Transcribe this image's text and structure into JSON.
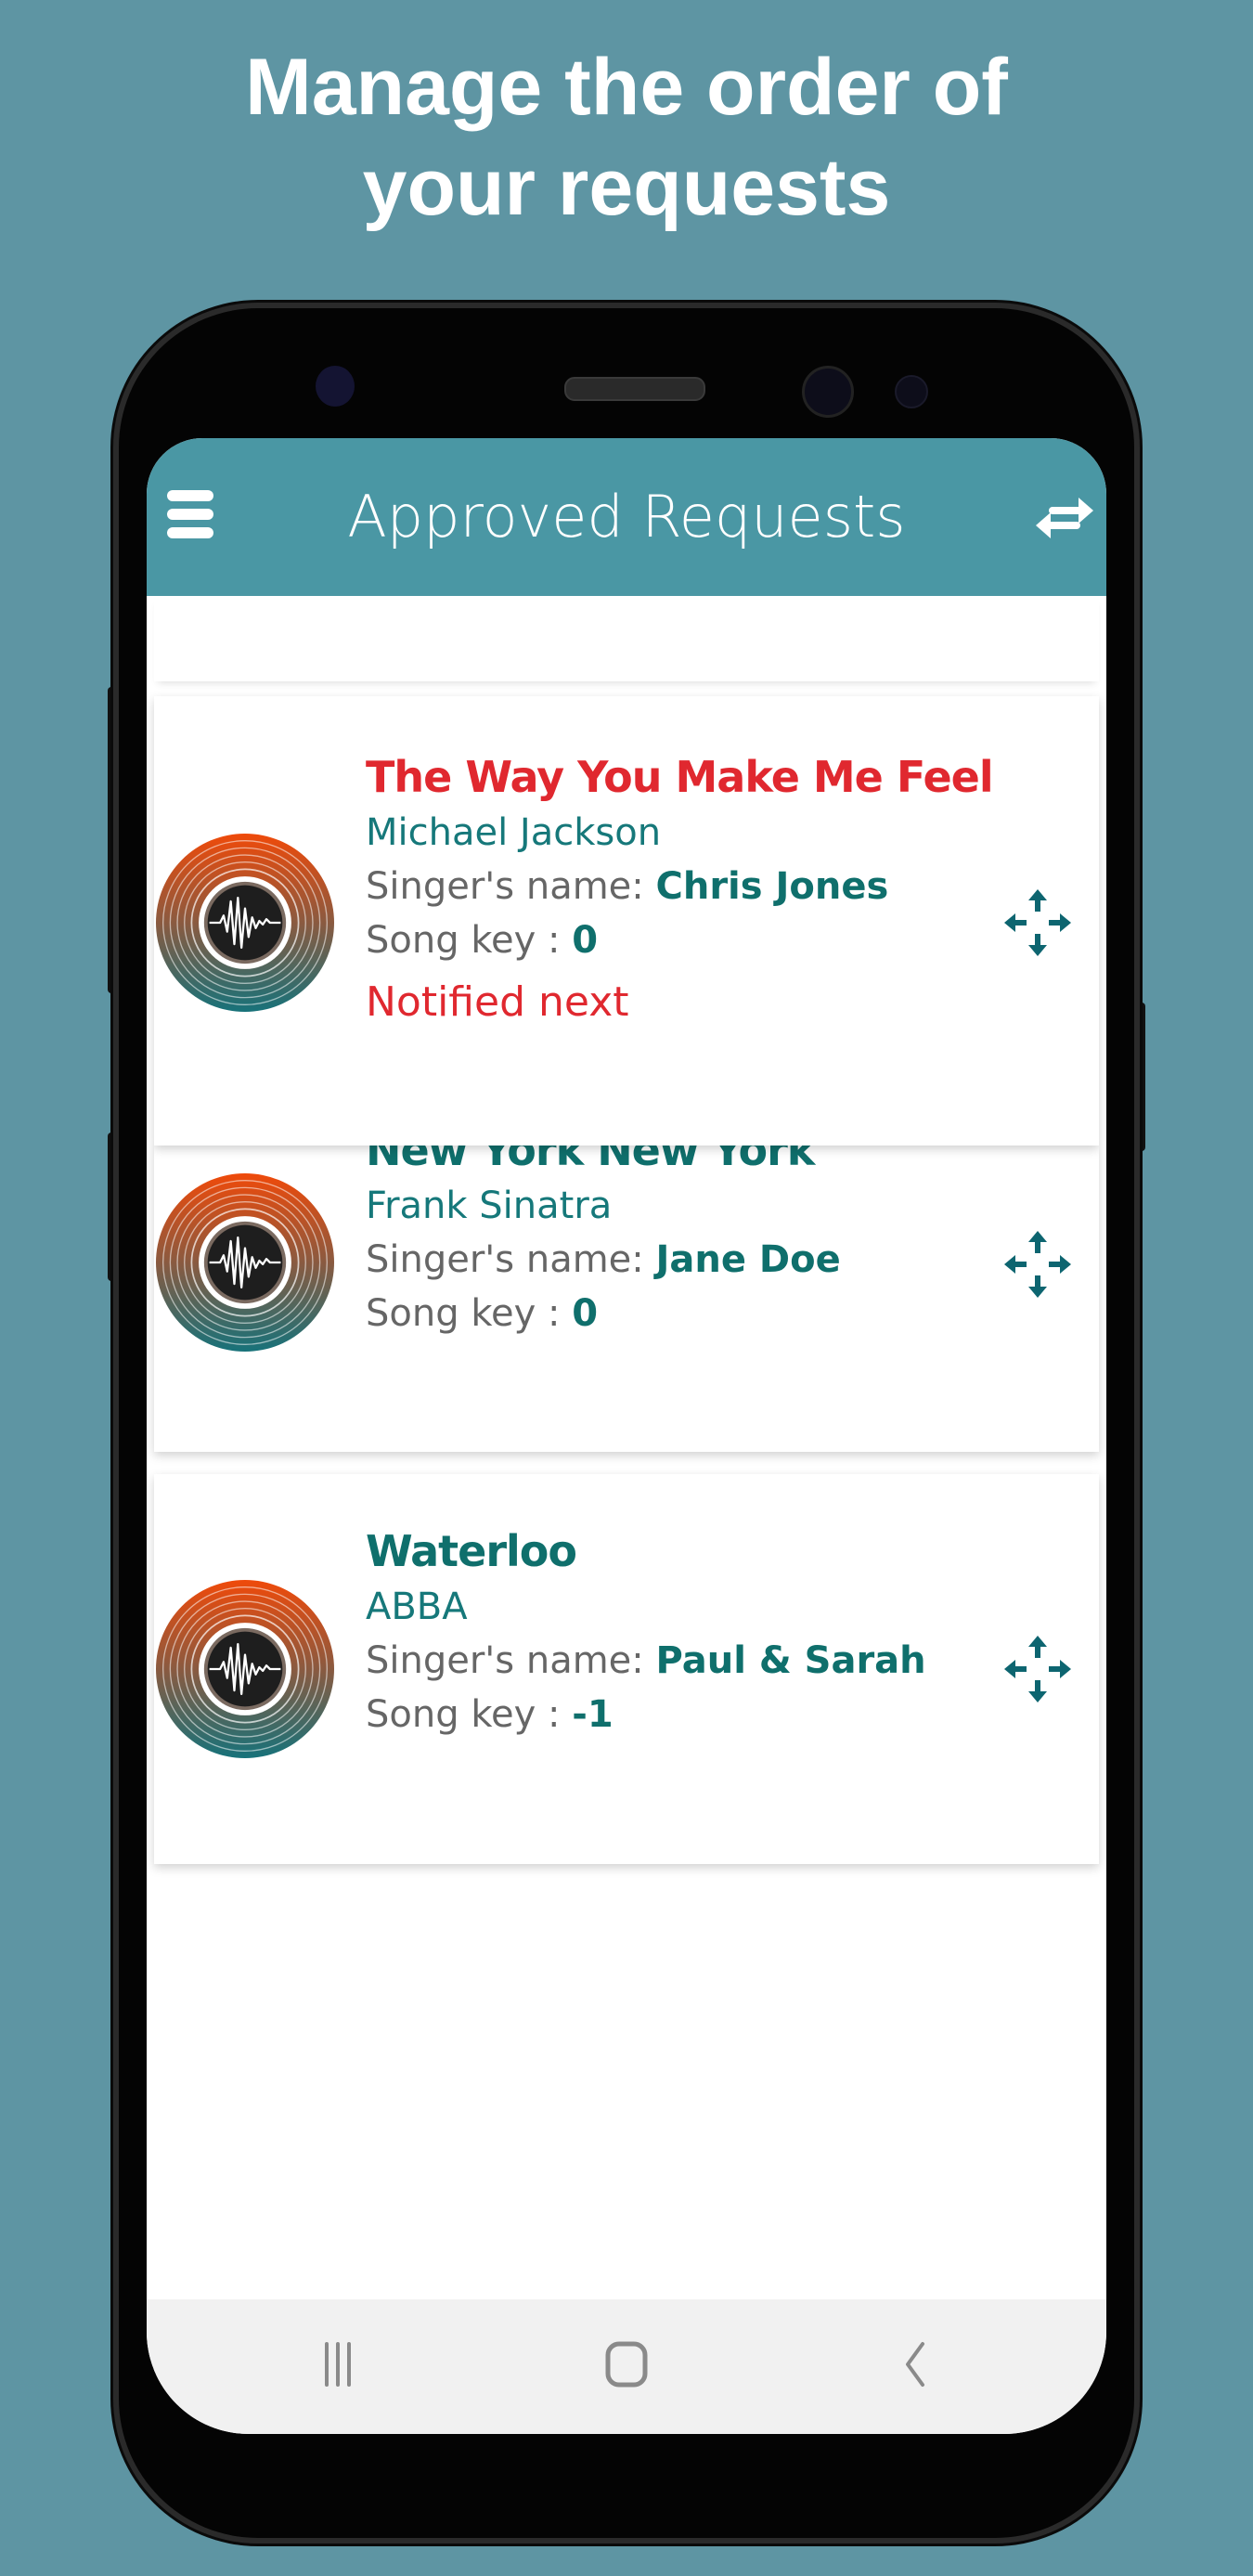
{
  "promo": {
    "line1": "Manage the order of",
    "line2": "your requests"
  },
  "appbar": {
    "title": "Approved Requests",
    "menu_icon": "hamburger-menu-icon",
    "sort_icon": "swap-arrows-icon"
  },
  "colors": {
    "background": "#5e95a3",
    "appbar": "#4a97a4",
    "accent_teal": "#0f6f6c",
    "alert_red": "#e0282f"
  },
  "labels": {
    "singer_prefix": "Singer's name: ",
    "key_prefix": "Song key : "
  },
  "requests": [
    {
      "song": "The Way You Make Me Feel",
      "artist": "Michael Jackson",
      "singer": "Chris Jones",
      "key": "0",
      "status": "Notified next",
      "highlighted": true
    },
    {
      "song": "New York New York",
      "artist": "Frank Sinatra",
      "singer": "Jane Doe",
      "key": "0",
      "status": "",
      "highlighted": false
    },
    {
      "song": "Waterloo",
      "artist": "ABBA",
      "singer": "Paul & Sarah",
      "key": "-1",
      "status": "",
      "highlighted": false
    }
  ],
  "navbar": {
    "recents_icon": "recent-apps-icon",
    "home_icon": "home-icon",
    "back_icon": "back-icon"
  }
}
